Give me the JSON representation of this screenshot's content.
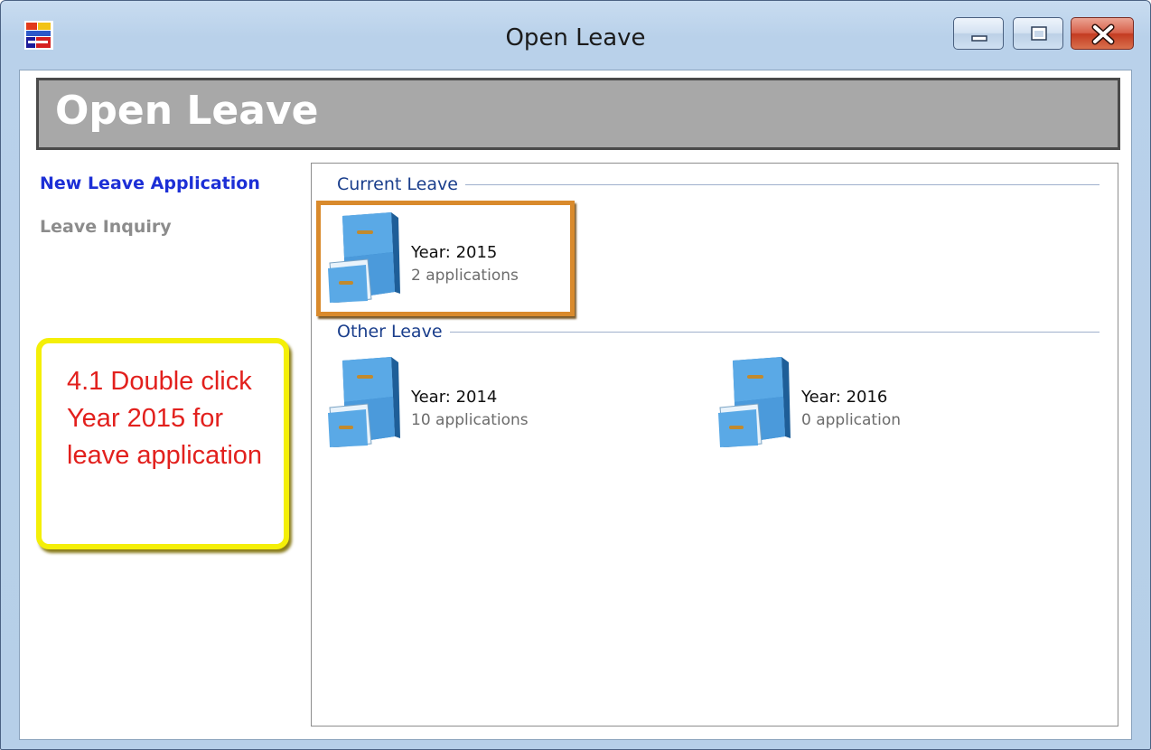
{
  "window": {
    "title": "Open Leave",
    "controls": {
      "minimize_icon": "minimize-icon",
      "maximize_icon": "maximize-icon",
      "close_icon": "close-icon"
    }
  },
  "banner": {
    "title": "Open Leave"
  },
  "nav": {
    "items": [
      {
        "label": "New Leave Application",
        "color": "#1c2fd6"
      },
      {
        "label": "Leave Inquiry",
        "color": "#8c8c8c"
      }
    ]
  },
  "callout": {
    "text": "4.1 Double click Year 2015 for leave application",
    "border_color": "#f4ef08",
    "text_color": "#e2201d"
  },
  "groups": {
    "current": {
      "label": "Current Leave",
      "items": [
        {
          "year": "Year: 2015",
          "count": "2 applications",
          "icon": "file-cabinet-icon"
        }
      ]
    },
    "other": {
      "label": "Other Leave",
      "items": [
        {
          "year": "Year: 2014",
          "count": "10 applications",
          "icon": "file-cabinet-icon"
        },
        {
          "year": "Year: 2016",
          "count": "0 application",
          "icon": "file-cabinet-icon"
        }
      ]
    }
  },
  "highlight_color": "#d98a2c"
}
